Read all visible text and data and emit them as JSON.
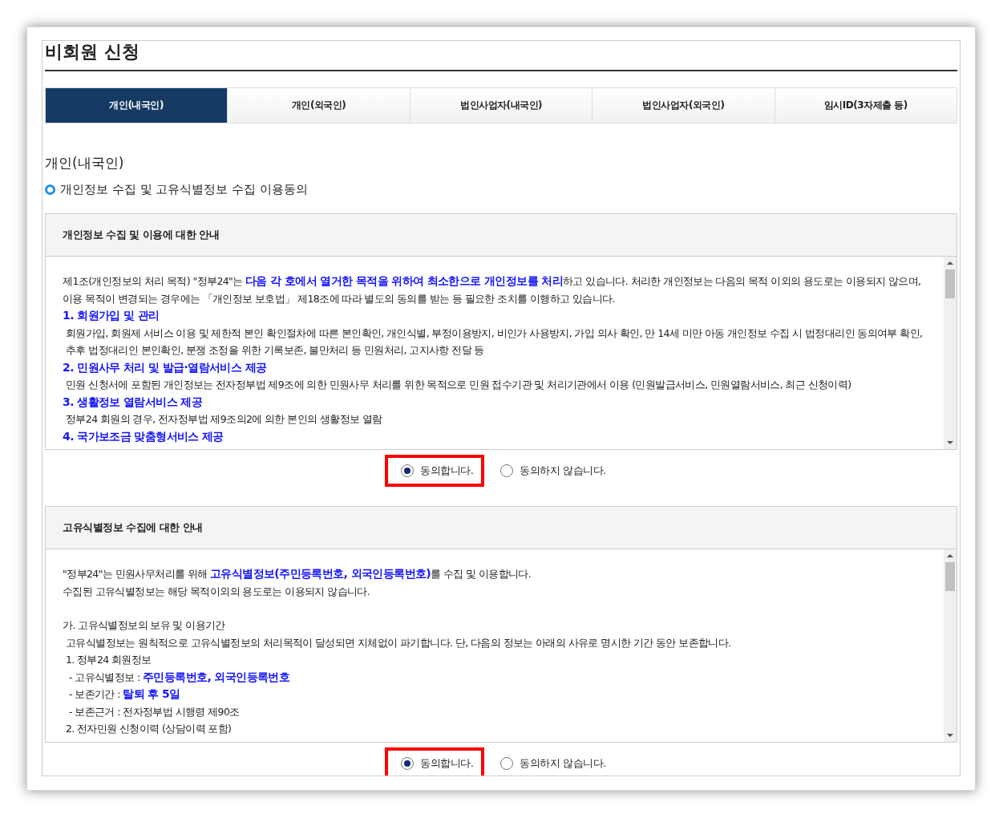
{
  "page_title": "비회원 신청",
  "tabs": [
    {
      "label": "개인(내국인)",
      "selected": true
    },
    {
      "label": "개인(외국인)",
      "selected": false
    },
    {
      "label": "법인사업자(내국인)",
      "selected": false
    },
    {
      "label": "법인사업자(외국인)",
      "selected": false
    },
    {
      "label": "임시ID(3자제출 등)",
      "selected": false
    }
  ],
  "section_title": "개인(내국인)",
  "subtitle": "개인정보 수집 및 고유식별정보 수집 이용동의",
  "agreements": [
    {
      "heading": "개인정보 수집 및 이용에 대한 안내",
      "lines": [
        {
          "kind": "text",
          "text": "제1조(개인정보의 처리 목적) \"정부24\"는 **다음 각 호에서 열거한 목적을 위하여 최소한으로 개인정보를 처리**하고 있습니다. 처리한 개인정보는 다음의 목적 이외의 용도로는 이용되지 않으며, 이용 목적이 변경되는 경우에는 「개인정보 보호법」 제18조에 따라 별도의 동의를 받는 등 필요한 조치를 이행하고 있습니다."
        },
        {
          "kind": "heading",
          "text": "1. 회원가입 및 관리"
        },
        {
          "kind": "body",
          "text": "회원가입, 회원제 서비스 이용 및 제한적 본인 확인절차에 따른 본인확인, 개인식별, 부정이용방지, 비인가 사용방지, 가입 의사 확인, 만 14세 미만 아동 개인정보 수집 시 법정대리인 동의여부 확인, 추후 법정대리인 본인확인, 분쟁 조정을 위한 기록보존, 불만처리 등 민원처리, 고지사항 전달 등"
        },
        {
          "kind": "heading",
          "text": "2. 민원사무 처리 및 발급·열람서비스 제공"
        },
        {
          "kind": "body",
          "text": "민원 신청서에 포함된 개인정보는 전자정부법 제9조에 의한 민원사무 처리를 위한 목적으로 민원 접수기관 및 처리기관에서 이용 (민원발급서비스, 민원열람서비스, 최근 신청이력)"
        },
        {
          "kind": "heading",
          "text": "3. 생활정보 열람서비스 제공"
        },
        {
          "kind": "body",
          "text": "정부24 회원의 경우, 전자정부법 제9조의2에 의한 본인의 생활정보 열람"
        },
        {
          "kind": "heading",
          "text": "4. 국가보조금 맞춤형서비스 제공"
        }
      ],
      "options": [
        {
          "label": "동의합니다.",
          "selected": true,
          "highlighted": true
        },
        {
          "label": "동의하지 않습니다.",
          "selected": false,
          "highlighted": false
        }
      ]
    },
    {
      "heading": "고유식별정보 수집에 대한 안내",
      "lines": [
        {
          "kind": "text",
          "text": "\"정부24\"는 민원사무처리를 위해 **고유식별정보(주민등록번호, 외국인등록번호)**를 수집 및 이용합니다."
        },
        {
          "kind": "text",
          "text": "수집된 고유식별정보는 해당 목적이외의 용도로는 이용되지 않습니다."
        },
        {
          "kind": "gap_text",
          "text": "가. 고유식별정보의 보유 및 이용기간"
        },
        {
          "kind": "body",
          "text": "고유식별정보는 원칙적으로 고유식별정보의 처리목적이 달성되면 지체없이 파기합니다. 단, 다음의 정보는 아래의 사유로 명시한 기간 동안 보존합니다."
        },
        {
          "kind": "body",
          "text": "1. 정부24 회원정보"
        },
        {
          "kind": "sub",
          "text": "- 고유식별정보 : **주민등록번호, 외국인등록번호**"
        },
        {
          "kind": "sub",
          "text": "- 보존기간 : **탈퇴 후 5일**"
        },
        {
          "kind": "sub",
          "text": "- 보존근거 : 전자정부법 시행령 제90조"
        },
        {
          "kind": "body",
          "text": "2. 전자민원 신청이력 (상담이력 포함)"
        }
      ],
      "options": [
        {
          "label": "동의합니다.",
          "selected": true,
          "highlighted": true
        },
        {
          "label": "동의하지 않습니다.",
          "selected": false,
          "highlighted": false
        }
      ]
    }
  ]
}
